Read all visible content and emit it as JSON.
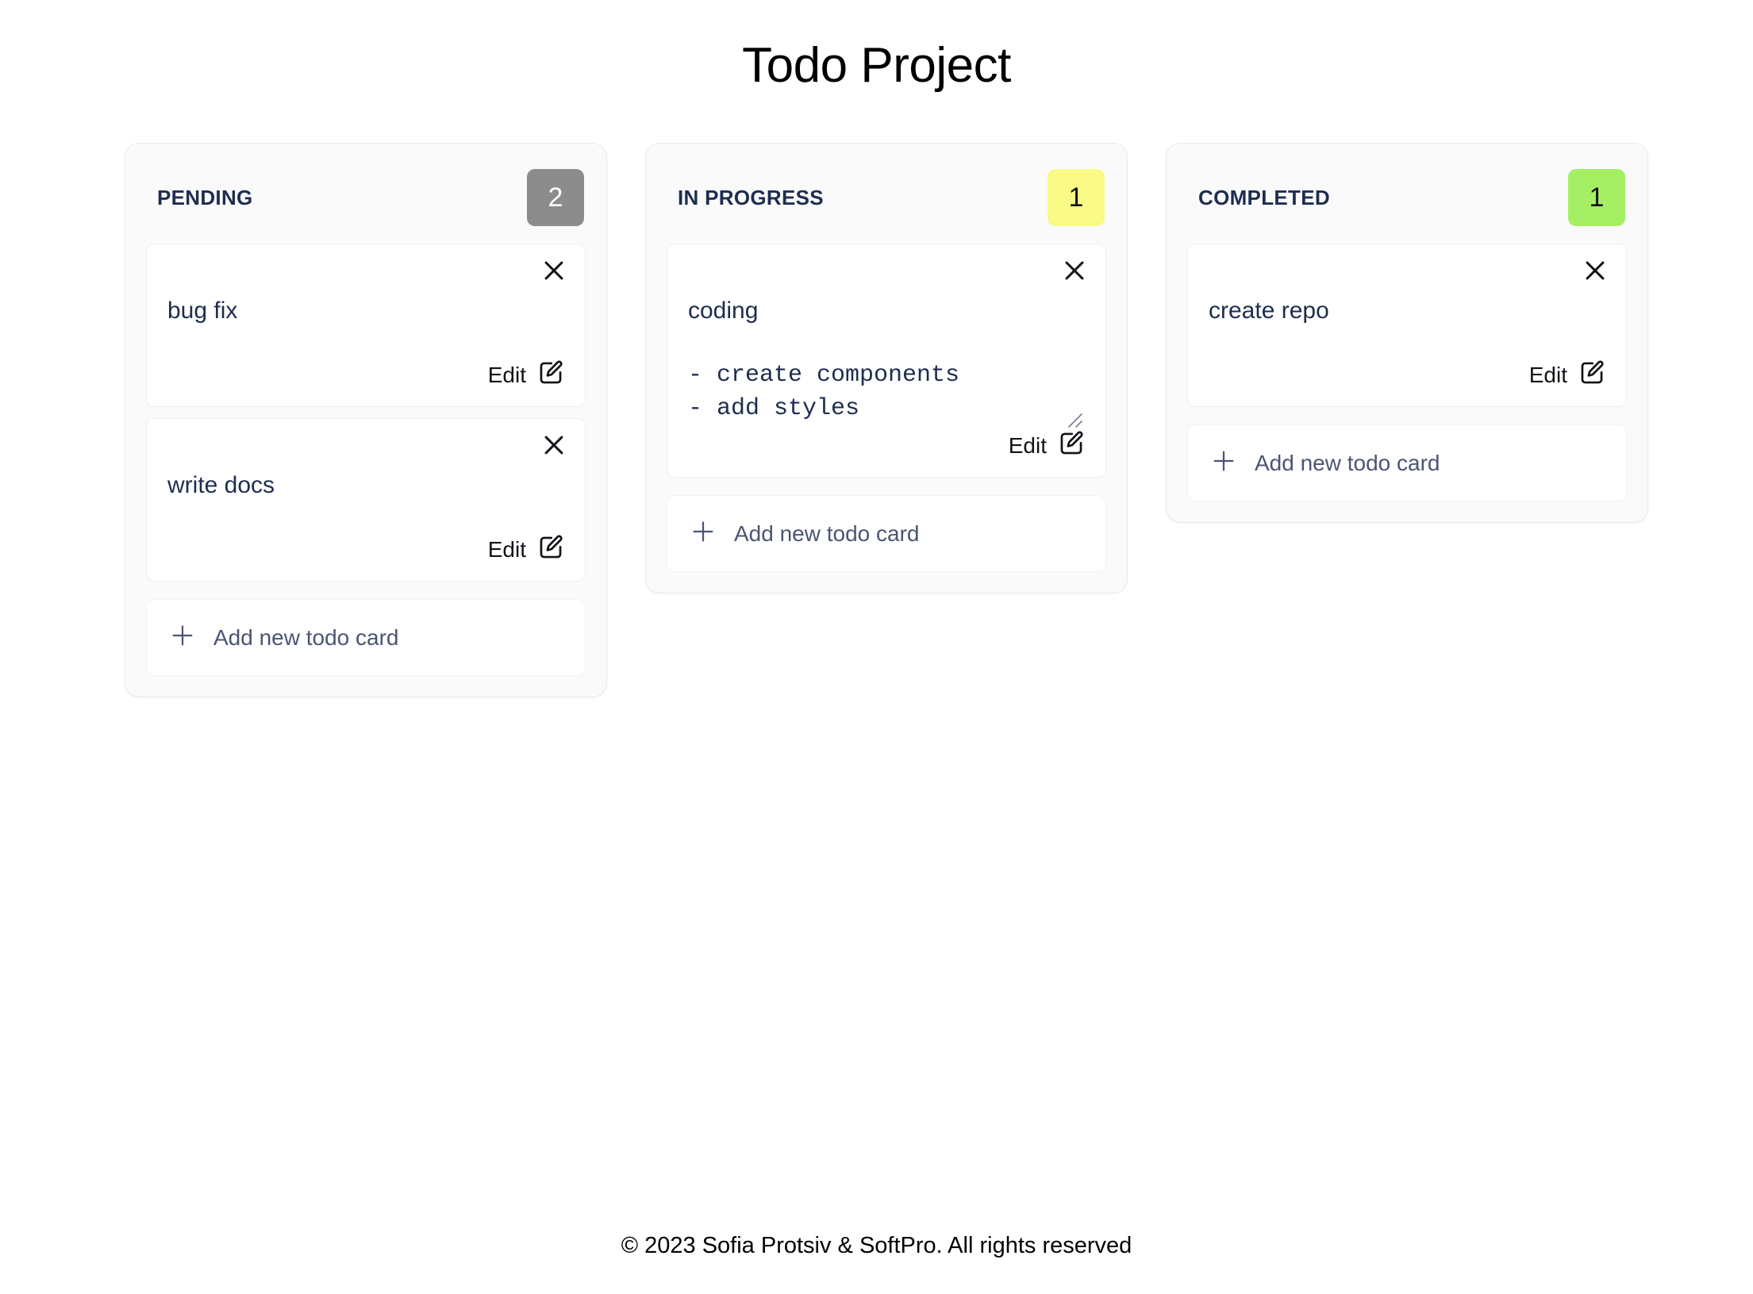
{
  "header": {
    "title": "Todo Project"
  },
  "columns": [
    {
      "id": "pending",
      "title": "PENDING",
      "count": "2",
      "badge_bg": "#8c8c8c",
      "badge_fg": "#ffffff",
      "add_label": "Add new todo card",
      "cards": [
        {
          "text": "bug fix",
          "edit_label": "Edit",
          "editing": false
        },
        {
          "text": "write docs",
          "edit_label": "Edit",
          "editing": false
        }
      ]
    },
    {
      "id": "in-progress",
      "title": "IN PROGRESS",
      "count": "1",
      "badge_bg": "#fafa86",
      "badge_fg": "#111318",
      "add_label": "Add new todo card",
      "cards": [
        {
          "text": "coding",
          "body": "- create components\n- add styles",
          "edit_label": "Edit",
          "editing": true
        }
      ]
    },
    {
      "id": "completed",
      "title": "COMPLETED",
      "count": "1",
      "badge_bg": "#a5ef64",
      "badge_fg": "#111318",
      "add_label": "Add new todo card",
      "cards": [
        {
          "text": "create repo",
          "edit_label": "Edit",
          "editing": false
        }
      ]
    }
  ],
  "icons": {
    "close": "close-icon",
    "edit": "square-pen-icon",
    "add": "plus-icon",
    "resize": "resize-grip-icon"
  },
  "footer": {
    "copyright": "© 2023 Sofia Protsiv & SoftPro. All rights reserved"
  }
}
